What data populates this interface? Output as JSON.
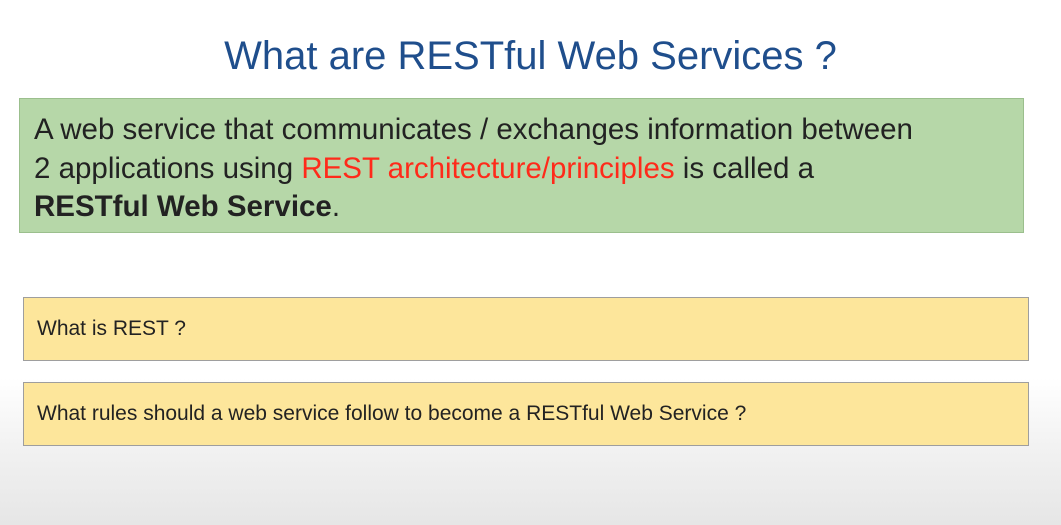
{
  "slide": {
    "title": "What are RESTful Web Services ?",
    "definition": {
      "line1": "A web service that communicates / exchanges information between",
      "line2_prefix": "2 applications using ",
      "line2_highlight": "REST architecture/principles",
      "line2_suffix": " is called a",
      "bold_term": "RESTful Web Service",
      "end_punct": "."
    },
    "questions": [
      {
        "text": "What is REST ?"
      },
      {
        "text": "What rules should a web service follow to become a RESTful Web Service ?"
      }
    ]
  },
  "colors": {
    "title": "#1f4e8c",
    "definition_background": "#b6d7a8",
    "highlight": "#ff2a1a",
    "question_background": "#fde69b"
  }
}
